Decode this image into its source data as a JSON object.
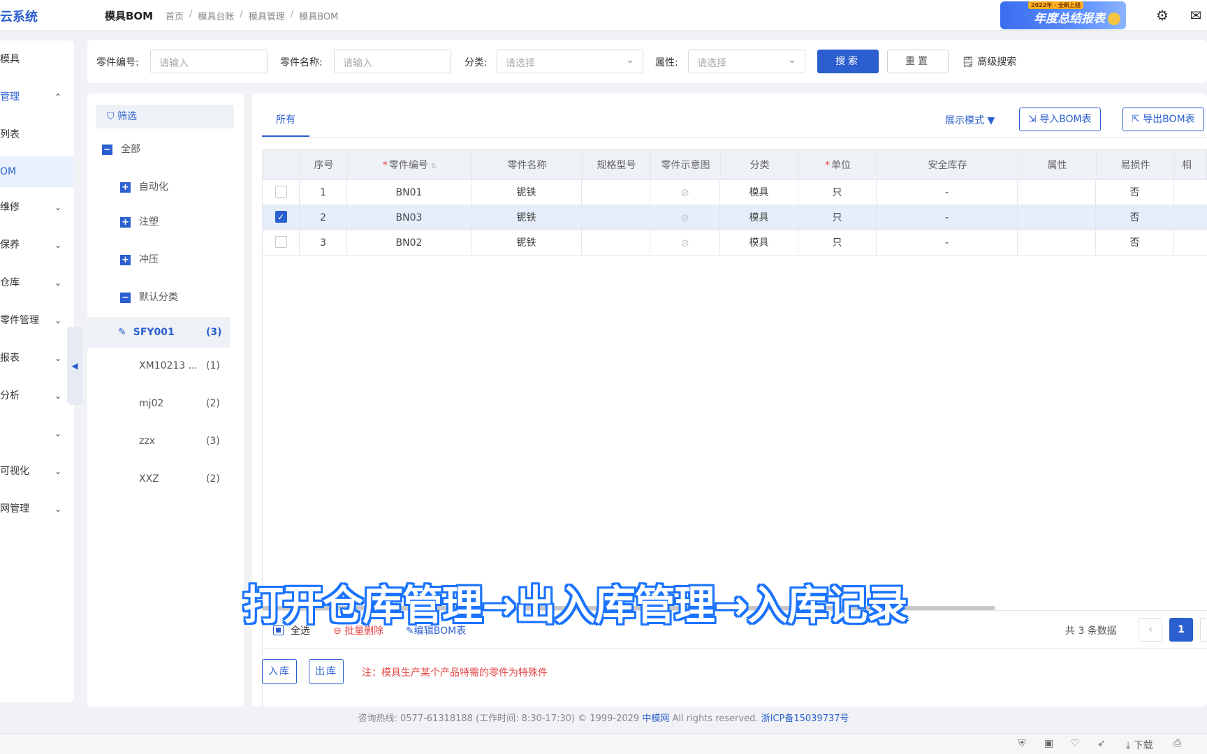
{
  "topbar": {
    "logo": "云系统",
    "page_name": "模具BOM",
    "breadcrumb": [
      "首页",
      "模具台账",
      "模具管理",
      "模具BOM"
    ],
    "banner_text": "年度总结报表",
    "banner_tag": "2022年 · 全新上线"
  },
  "sidebar": {
    "items": [
      {
        "label": "模具",
        "chevron": ""
      },
      {
        "label": "管理",
        "chevron": "⌃"
      },
      {
        "label": "列表",
        "chevron": ""
      },
      {
        "label": "OM",
        "chevron": ""
      },
      {
        "label": "维修",
        "chevron": "⌄"
      },
      {
        "label": "保养",
        "chevron": "⌄"
      },
      {
        "label": "仓库",
        "chevron": "⌄"
      },
      {
        "label": "零件管理",
        "chevron": "⌄"
      },
      {
        "label": "报表",
        "chevron": "⌄"
      },
      {
        "label": "分析",
        "chevron": "⌄"
      },
      {
        "label": "",
        "chevron": "⌄"
      },
      {
        "label": "可视化",
        "chevron": "⌄"
      },
      {
        "label": "网管理",
        "chevron": "⌄"
      }
    ]
  },
  "search": {
    "part_no_label": "零件编号:",
    "part_no_placeholder": "请输入",
    "part_name_label": "零件名称:",
    "part_name_placeholder": "请输入",
    "category_label": "分类:",
    "category_placeholder": "请选择",
    "attribute_label": "属性:",
    "attribute_placeholder": "请选择",
    "search_btn": "搜索",
    "reset_btn": "重置",
    "advanced": "高级搜索"
  },
  "tree": {
    "filter_label": "筛选",
    "nodes": [
      {
        "label": "全部",
        "box": "−"
      },
      {
        "label": "自动化",
        "box": "+"
      },
      {
        "label": "注塑",
        "box": "+"
      },
      {
        "label": "冲压",
        "box": "+"
      },
      {
        "label": "默认分类",
        "box": "−"
      }
    ],
    "leaves": [
      {
        "label": "SFY001",
        "count": "(3)"
      },
      {
        "label": "XM10213 ...",
        "count": "(1)"
      },
      {
        "label": "mj02",
        "count": "(2)"
      },
      {
        "label": "zzx",
        "count": "(3)"
      },
      {
        "label": "XXZ",
        "count": "(2)"
      }
    ]
  },
  "main": {
    "tab_all": "所有",
    "display_mode": "展示模式 ▼",
    "import_btn": "导入BOM表",
    "export_btn": "导出BOM表",
    "columns": [
      "序号",
      "零件编号",
      "零件名称",
      "规格型号",
      "零件示意图",
      "分类",
      "单位",
      "安全库存",
      "属性",
      "易损件",
      "相"
    ],
    "rows": [
      {
        "index": "1",
        "part_no": "BN01",
        "part_name": "铌铁",
        "spec": "",
        "category": "模具",
        "unit": "只",
        "safety_stock": "-",
        "attribute": "",
        "wearable": "否",
        "checked": false
      },
      {
        "index": "2",
        "part_no": "BN03",
        "part_name": "铌铁",
        "spec": "",
        "category": "模具",
        "unit": "只",
        "safety_stock": "-",
        "attribute": "",
        "wearable": "否",
        "checked": true
      },
      {
        "index": "3",
        "part_no": "BN02",
        "part_name": "铌铁",
        "spec": "",
        "category": "模具",
        "unit": "只",
        "safety_stock": "-",
        "attribute": "",
        "wearable": "否",
        "checked": false
      }
    ],
    "select_all": "全选",
    "batch_delete": "批量删除",
    "edit_bom": "编辑BOM表",
    "total": "共 3 条数据",
    "current_page": "1",
    "stock_in": "入库",
    "stock_out": "出库",
    "note": "注：模具生产某个产品特需的零件为特殊件"
  },
  "caption": "打开仓库管理→出入库管理→入库记录",
  "footer": {
    "text": "咨询热线: 0577-61318188 (工作时间: 8:30-17:30) © 1999-2029",
    "brand": "中模网",
    "rights": "All rights reserved.",
    "icp": "浙ICP备15039737号"
  },
  "browser": {
    "download": "下载"
  },
  "colors": {
    "accent": "#2b5fcf",
    "danger": "#e54545",
    "selected_row": "#e6eefc"
  }
}
